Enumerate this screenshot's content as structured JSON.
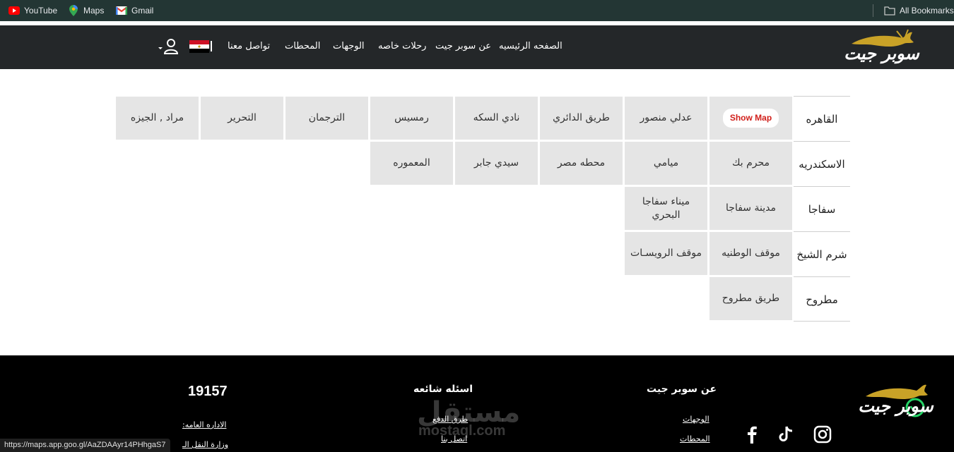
{
  "bookmarks": {
    "items": [
      {
        "label": "YouTube",
        "icon": "youtube-icon"
      },
      {
        "label": "Maps",
        "icon": "maps-pin-icon"
      },
      {
        "label": "Gmail",
        "icon": "gmail-icon"
      }
    ],
    "all_label": "All Bookmarks"
  },
  "nav": {
    "logo_text": "سوبر جيت",
    "links": [
      "الصفحه الرئيسيه",
      "عن سوبر جيت",
      "رحلات خاصه",
      "الوجهات",
      "المحطات",
      "تواصل معنا"
    ]
  },
  "table": {
    "show_map_label": "Show Map",
    "rows": [
      {
        "city": "القاهره",
        "stations": [
          "عدلي منصور",
          "طريق الدائري",
          "نادي السكه",
          "رمسيس",
          "الترجمان",
          "التحرير",
          "مراد , الجيزه"
        ]
      },
      {
        "city": "الاسكندريه",
        "stations": [
          "محرم بك",
          "ميامي",
          "محطه مصر",
          "سيدي جابر",
          "المعموره"
        ]
      },
      {
        "city": "سفاجا",
        "stations": [
          "مدينة سفاجا",
          "ميناء سفاجا البحري"
        ]
      },
      {
        "city": "شرم الشيخ",
        "stations": [
          "موقف الوطنيه",
          "موقف الرويسـات"
        ]
      },
      {
        "city": "مطروح",
        "stations": [
          "طريق مطروح"
        ]
      }
    ]
  },
  "footer": {
    "logo_text": "سوبر جيت",
    "about": {
      "title": "عن سوبر جيت",
      "links": [
        "الوجهات",
        "المحطات"
      ]
    },
    "faq": {
      "title": "اسئله شائعه",
      "links": [
        "طرق الدفع",
        "اتصل بنا"
      ]
    },
    "hotline": "19157",
    "contact_links": [
      "الاداره العامه:",
      "وزارة النقل الـ"
    ],
    "watermark": "مستقل",
    "watermark_domain": "mostaql.com",
    "social": [
      "instagram-icon",
      "tiktok-icon",
      "facebook-icon"
    ]
  },
  "status_url": "https://maps.app.goo.gl/AaZDAAyr14PHhgaS7",
  "colors": {
    "header_bg": "#242729",
    "accent_gold": "#c9a227",
    "show_map_red": "#d1201b",
    "cell_bg": "#e5e5e5"
  }
}
